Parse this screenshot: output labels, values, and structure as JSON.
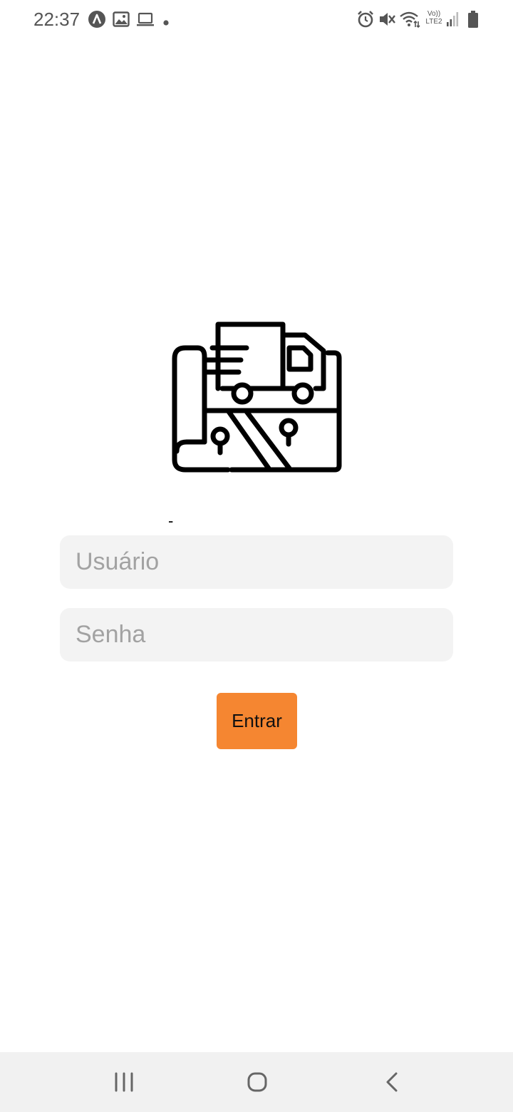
{
  "status_bar": {
    "time": "22:37",
    "left_icons": [
      "navigation-app-icon",
      "gallery-notification-icon",
      "laptop-notification-icon",
      "more-notifications-dot-icon"
    ],
    "right_icons": [
      "alarm-icon",
      "mute-icon",
      "wifi-icon",
      "volte-lte2-icon",
      "signal-icon",
      "battery-icon"
    ],
    "network_top": "Vo))",
    "network_bottom": "LTE2"
  },
  "logo": {
    "icon": "map-truck-delivery-icon",
    "color": "#000000"
  },
  "dash_text": "-",
  "form": {
    "username_placeholder": "Usuário",
    "password_placeholder": "Senha",
    "submit_label": "Entrar",
    "accent_color": "#f58631"
  },
  "nav_bar": {
    "buttons": [
      "recents-icon",
      "home-icon",
      "back-icon"
    ]
  }
}
